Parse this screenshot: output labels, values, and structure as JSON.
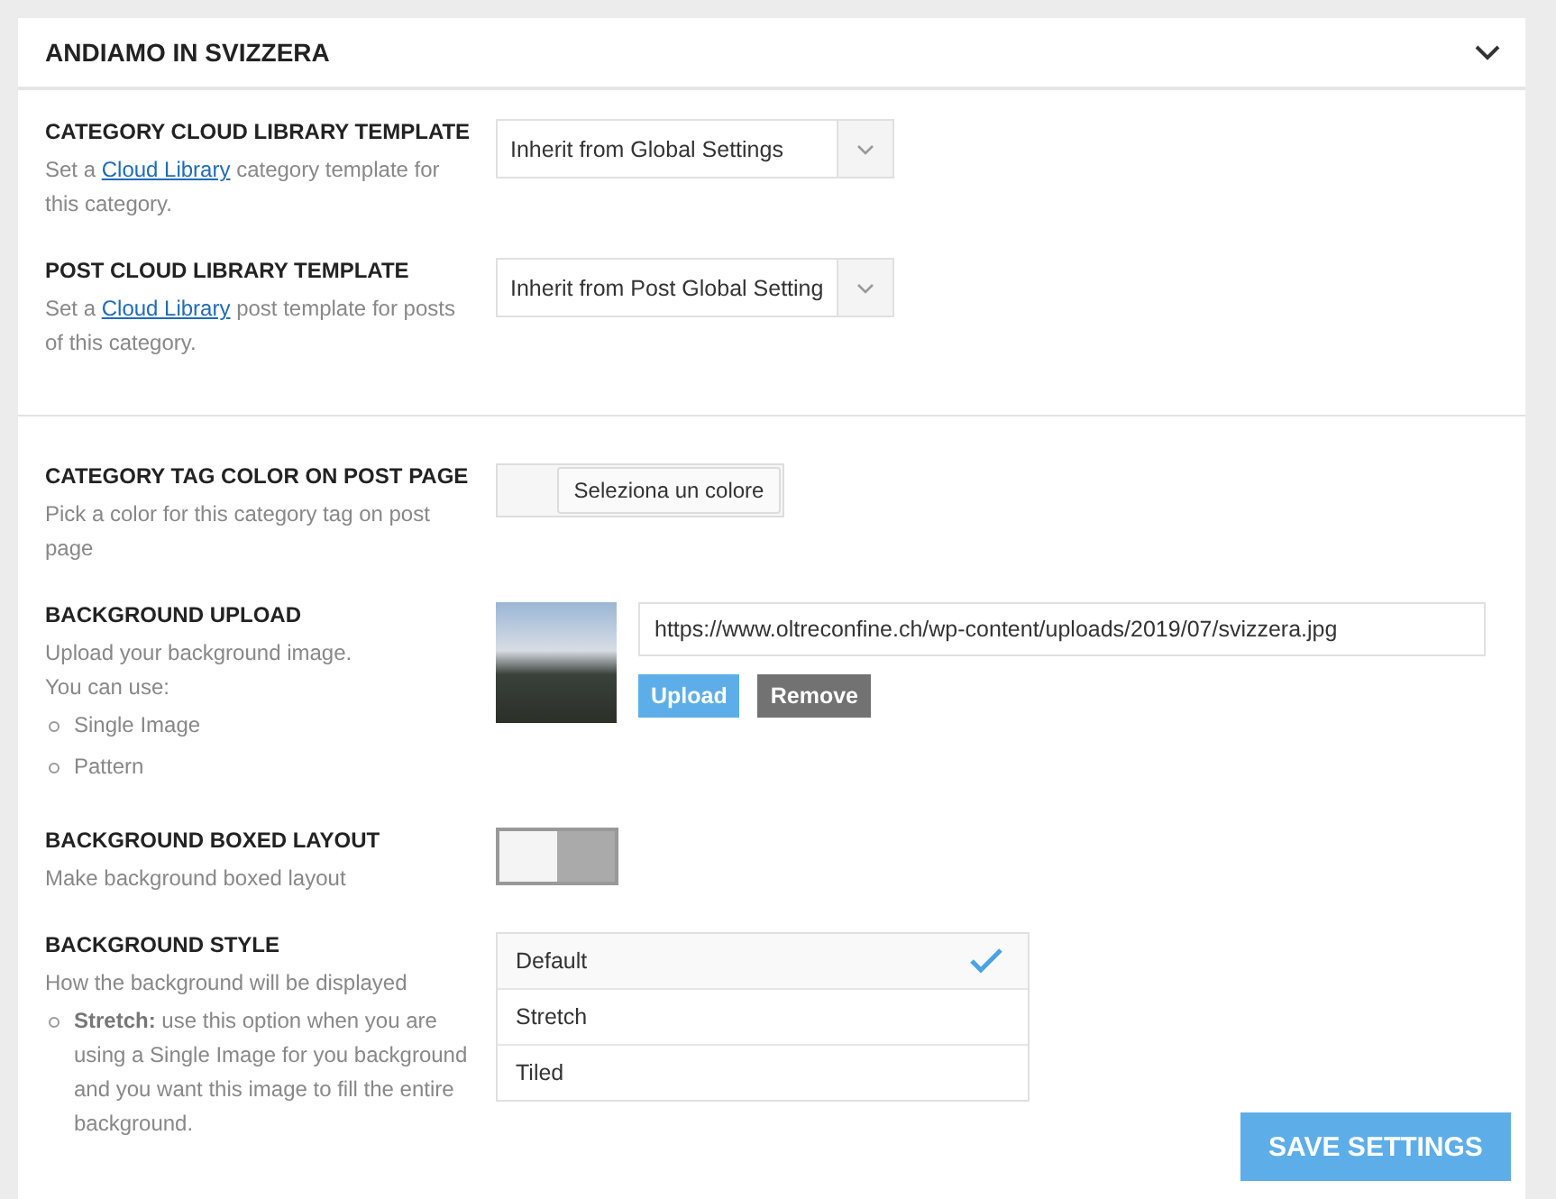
{
  "panel": {
    "title": "ANDIAMO IN SVIZZERA",
    "expanded": true
  },
  "sections": [
    {
      "settings": [
        {
          "kind": "select",
          "label": "CATEGORY CLOUD LIBRARY TEMPLATE",
          "description": {
            "before": "Set a ",
            "link": "Cloud Library",
            "after": " category template for this category."
          },
          "value": "Inherit from Global Settings"
        },
        {
          "kind": "select",
          "label": "POST CLOUD LIBRARY TEMPLATE",
          "description": {
            "before": "Set a ",
            "link": "Cloud Library",
            "after": " post template for posts of this category."
          },
          "value": "Inherit from Post Global Setting"
        }
      ]
    },
    {
      "settings": [
        {
          "kind": "color",
          "label": "CATEGORY TAG COLOR ON POST PAGE",
          "description": {
            "before": "Pick a color for this category tag on post page"
          },
          "button": "Seleziona un colore"
        },
        {
          "kind": "upload",
          "label": "BACKGROUND UPLOAD",
          "description": {
            "before": "Upload your background image.\nYou can use:"
          },
          "bullets": [
            "Single Image",
            "Pattern"
          ],
          "url": "https://www.oltreconfine.ch/wp-content/uploads/2019/07/svizzera.jpg",
          "buttons": [
            "Upload",
            "Remove"
          ]
        },
        {
          "kind": "toggle",
          "label": "BACKGROUND BOXED LAYOUT",
          "description": {
            "before": "Make background boxed layout"
          },
          "on": false
        },
        {
          "kind": "radio_list",
          "label": "BACKGROUND STYLE",
          "description": {
            "before": "How the background will be displayed"
          },
          "bullets": [
            "**Stretch:** use this option when you are using a Single Image for you background and you want this image to fill the entire background."
          ],
          "options": [
            {
              "label": "Default",
              "selected": true
            },
            {
              "label": "Stretch",
              "selected": false
            },
            {
              "label": "Tiled",
              "selected": false
            }
          ]
        }
      ]
    }
  ],
  "save_button": "SAVE SETTINGS"
}
